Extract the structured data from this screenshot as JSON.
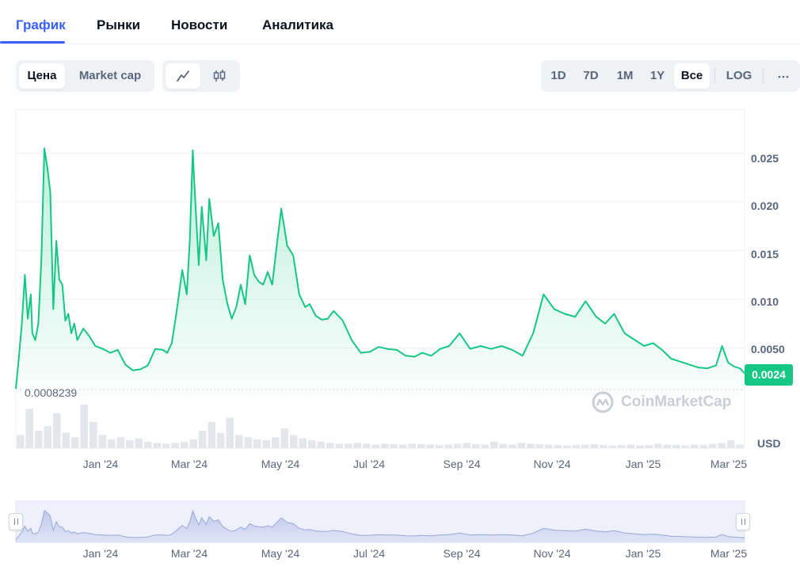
{
  "tabs": [
    {
      "label": "График",
      "active": true
    },
    {
      "label": "Рынки",
      "active": false
    },
    {
      "label": "Новости",
      "active": false
    },
    {
      "label": "Аналитика",
      "active": false
    }
  ],
  "toolbar": {
    "metric_options": [
      {
        "label": "Цена",
        "active": true
      },
      {
        "label": "Market cap",
        "active": false
      }
    ],
    "chart_styles": [
      {
        "icon": "line-chart-icon",
        "active": true
      },
      {
        "icon": "candlestick-icon",
        "active": false
      }
    ],
    "ranges": [
      {
        "label": "1D",
        "active": false
      },
      {
        "label": "7D",
        "active": false
      },
      {
        "label": "1M",
        "active": false
      },
      {
        "label": "1Y",
        "active": false
      },
      {
        "label": "Все",
        "active": true
      }
    ],
    "log_label": "LOG",
    "more_icon": "more-horizontal-icon"
  },
  "colors": {
    "accent": "#3861fb",
    "line": "#16c784",
    "price_tag": "#16c784"
  },
  "chart_data": {
    "type": "line",
    "y_axis": {
      "ticks": [
        "0.025",
        "0.020",
        "0.015",
        "0.010",
        "0.0050"
      ],
      "ylim": [
        0,
        0.0295
      ],
      "position": "right"
    },
    "x_axis": {
      "ticks": [
        "Jan '24",
        "Mar '24",
        "May '24",
        "Jul '24",
        "Sep '24",
        "Nov '24",
        "Jan '25",
        "Mar '25"
      ],
      "range": [
        "2023-11-17",
        "2025-03-17"
      ]
    },
    "current_price_label": "0.0024",
    "min_price_label": "0.0008239",
    "currency_label": "USD",
    "grid": true,
    "series": [
      {
        "x": [
          "2023-11-17",
          "2023-11-19",
          "2023-11-21",
          "2023-11-23",
          "2023-11-25",
          "2023-11-27",
          "2023-11-28",
          "2023-11-30",
          "2023-12-02",
          "2023-12-04",
          "2023-12-06",
          "2023-12-08",
          "2023-12-10",
          "2023-12-12",
          "2023-12-14",
          "2023-12-16",
          "2023-12-18",
          "2023-12-20",
          "2023-12-22",
          "2023-12-24",
          "2023-12-26",
          "2023-12-28",
          "2024-01-01",
          "2024-01-05",
          "2024-01-09",
          "2024-01-14",
          "2024-01-19",
          "2024-01-24",
          "2024-01-29",
          "2024-02-03",
          "2024-02-08",
          "2024-02-13",
          "2024-02-18",
          "2024-02-23",
          "2024-02-26",
          "2024-02-29",
          "2024-03-03",
          "2024-03-07",
          "2024-03-10",
          "2024-03-12",
          "2024-03-14",
          "2024-03-15",
          "2024-03-18",
          "2024-03-20",
          "2024-03-23",
          "2024-03-25",
          "2024-03-28",
          "2024-03-31",
          "2024-04-03",
          "2024-04-06",
          "2024-04-09",
          "2024-04-12",
          "2024-04-15",
          "2024-04-18",
          "2024-04-21",
          "2024-04-24",
          "2024-04-27",
          "2024-04-30",
          "2024-05-03",
          "2024-05-06",
          "2024-05-09",
          "2024-05-12",
          "2024-05-16",
          "2024-05-20",
          "2024-05-24",
          "2024-05-28",
          "2024-05-31",
          "2024-06-04",
          "2024-06-08",
          "2024-06-12",
          "2024-06-16",
          "2024-06-22",
          "2024-06-28",
          "2024-07-04",
          "2024-07-10",
          "2024-07-16",
          "2024-07-22",
          "2024-07-28",
          "2024-08-03",
          "2024-08-09",
          "2024-08-14",
          "2024-08-20",
          "2024-08-26",
          "2024-09-01",
          "2024-09-08",
          "2024-09-15",
          "2024-09-22",
          "2024-09-29",
          "2024-10-06",
          "2024-10-13",
          "2024-10-20",
          "2024-10-27",
          "2024-11-03",
          "2024-11-10",
          "2024-11-17",
          "2024-11-24",
          "2024-12-01",
          "2024-12-08",
          "2024-12-14",
          "2024-12-20",
          "2024-12-27",
          "2025-01-03",
          "2025-01-09",
          "2025-01-15",
          "2025-01-21",
          "2025-01-27",
          "2025-02-02",
          "2025-02-08",
          "2025-02-14",
          "2025-02-20",
          "2025-02-26",
          "2025-03-02",
          "2025-03-06",
          "2025-03-10",
          "2025-03-14",
          "2025-03-17"
        ],
        "y": [
          0.0008,
          0.004,
          0.0075,
          0.0125,
          0.008,
          0.0105,
          0.0065,
          0.0058,
          0.0075,
          0.014,
          0.0255,
          0.0235,
          0.021,
          0.009,
          0.016,
          0.012,
          0.0115,
          0.0078,
          0.0085,
          0.0065,
          0.0075,
          0.0058,
          0.007,
          0.0062,
          0.0052,
          0.0049,
          0.0045,
          0.0048,
          0.0033,
          0.0027,
          0.0028,
          0.0032,
          0.0049,
          0.0048,
          0.0045,
          0.0055,
          0.0085,
          0.013,
          0.0105,
          0.016,
          0.0253,
          0.022,
          0.0135,
          0.0195,
          0.014,
          0.0203,
          0.0165,
          0.0178,
          0.012,
          0.0096,
          0.008,
          0.0092,
          0.0115,
          0.0095,
          0.0145,
          0.0125,
          0.0118,
          0.0115,
          0.0128,
          0.0115,
          0.0155,
          0.0193,
          0.0155,
          0.0145,
          0.0105,
          0.0092,
          0.0095,
          0.0083,
          0.0079,
          0.008,
          0.0088,
          0.0078,
          0.0058,
          0.0045,
          0.0046,
          0.0051,
          0.0049,
          0.0048,
          0.0042,
          0.0041,
          0.0045,
          0.0042,
          0.0049,
          0.0052,
          0.0065,
          0.0049,
          0.0052,
          0.0049,
          0.0052,
          0.0048,
          0.0042,
          0.0065,
          0.0105,
          0.009,
          0.0085,
          0.0082,
          0.0098,
          0.0082,
          0.0075,
          0.0085,
          0.0065,
          0.0058,
          0.0052,
          0.0055,
          0.0048,
          0.0039,
          0.0036,
          0.0033,
          0.003,
          0.0029,
          0.0032,
          0.0052,
          0.0035,
          0.0031,
          0.0029,
          0.0024
        ]
      }
    ],
    "volume": [
      0.3,
      0.9,
      0.4,
      0.5,
      0.8,
      0.35,
      0.25,
      1.0,
      0.6,
      0.3,
      0.2,
      0.25,
      0.18,
      0.22,
      0.15,
      0.12,
      0.1,
      0.12,
      0.15,
      0.2,
      0.4,
      0.6,
      0.35,
      0.7,
      0.3,
      0.25,
      0.2,
      0.18,
      0.25,
      0.45,
      0.3,
      0.22,
      0.18,
      0.15,
      0.12,
      0.1,
      0.1,
      0.12,
      0.1,
      0.08,
      0.1,
      0.09,
      0.08,
      0.1,
      0.09,
      0.08,
      0.07,
      0.08,
      0.1,
      0.12,
      0.09,
      0.08,
      0.15,
      0.1,
      0.08,
      0.12,
      0.1,
      0.09,
      0.08,
      0.07,
      0.06,
      0.07,
      0.08,
      0.09,
      0.07,
      0.06,
      0.07,
      0.08,
      0.06,
      0.07,
      0.1,
      0.08,
      0.07,
      0.06,
      0.08,
      0.07,
      0.1,
      0.12,
      0.18,
      0.08
    ],
    "navigator_x_ticks": [
      "Jan '24",
      "Mar '24",
      "May '24",
      "Jul '24",
      "Sep '24",
      "Nov '24",
      "Jan '25",
      "Mar '25"
    ]
  },
  "watermark_text": "CoinMarketCap"
}
